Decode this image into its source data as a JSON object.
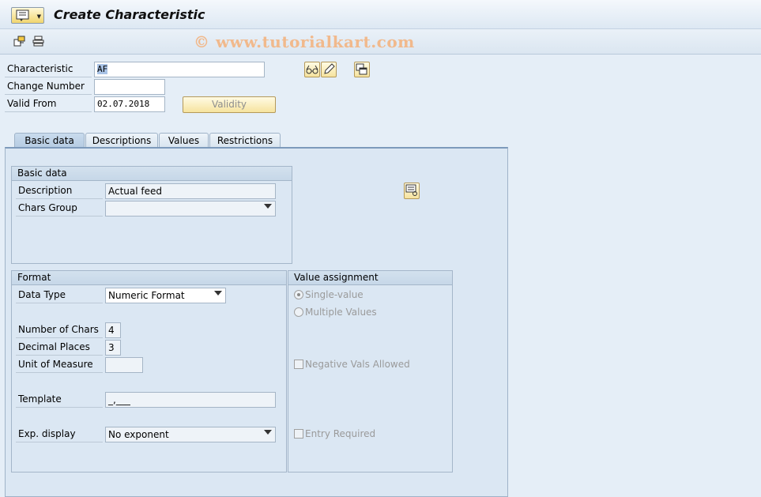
{
  "window": {
    "title": "Create Characteristic",
    "watermark": "© www.tutorialkart.com"
  },
  "header": {
    "characteristic_label": "Characteristic",
    "characteristic_value": "AF",
    "change_number_label": "Change Number",
    "change_number_value": "",
    "valid_from_label": "Valid From",
    "valid_from_value": "02.07.2018",
    "validity_button": "Validity"
  },
  "tabs": [
    {
      "label": "Basic data",
      "active": true
    },
    {
      "label": "Descriptions",
      "active": false
    },
    {
      "label": "Values",
      "active": false
    },
    {
      "label": "Restrictions",
      "active": false
    }
  ],
  "basic_data": {
    "heading": "Basic data",
    "description_label": "Description",
    "description_value": "Actual feed",
    "chars_group_label": "Chars Group",
    "chars_group_value": ""
  },
  "format": {
    "heading": "Format",
    "data_type_label": "Data Type",
    "data_type_value": "Numeric Format",
    "num_chars_label": "Number of Chars",
    "num_chars_value": "4",
    "decimal_places_label": "Decimal Places",
    "decimal_places_value": "3",
    "unit_label": "Unit of Measure",
    "unit_value": "",
    "template_label": "Template",
    "template_value": "_,___",
    "exp_display_label": "Exp. display",
    "exp_display_value": "No exponent"
  },
  "value_assignment": {
    "heading": "Value assignment",
    "single_value": "Single-value",
    "multiple_values": "Multiple Values",
    "negative_vals": "Negative Vals Allowed",
    "entry_required": "Entry Required",
    "selected": "Single-value"
  },
  "icons": [
    "menu-icon",
    "other-object-icon",
    "display-icon",
    "glasses-display-icon",
    "pencil-change-icon",
    "copy-window-icon",
    "classification-icon"
  ]
}
